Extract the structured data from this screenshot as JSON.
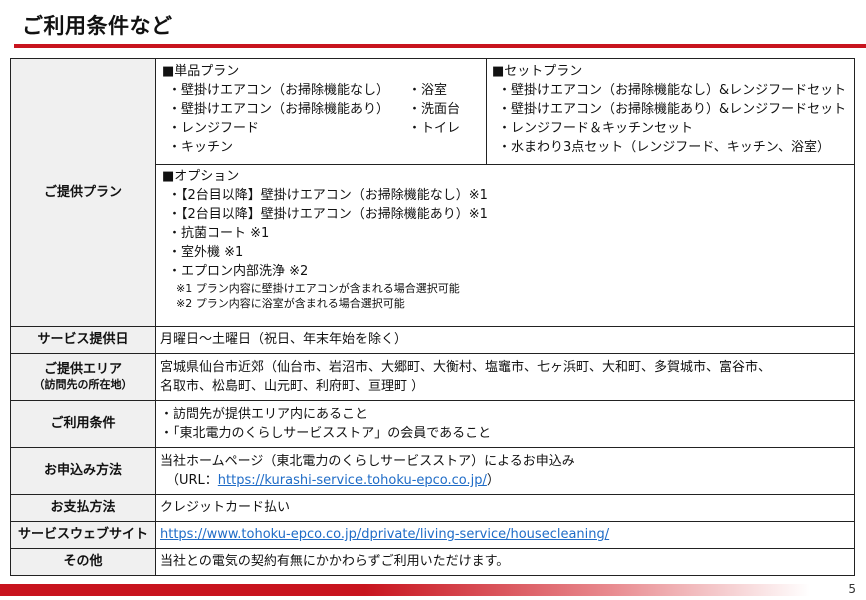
{
  "page_title": "ご利用条件など",
  "page_number": "5",
  "plans": {
    "label": "ご提供プラン",
    "single": {
      "heading": "■単品プラン",
      "col1": [
        "・壁掛けエアコン（お掃除機能なし）",
        "・壁掛けエアコン（お掃除機能あり）",
        "・レンジフード",
        "・キッチン"
      ],
      "col2": [
        "・浴室",
        "・洗面台",
        "・トイレ"
      ]
    },
    "set": {
      "heading": "■セットプラン",
      "items": [
        "・壁掛けエアコン（お掃除機能なし）&レンジフードセット",
        "・壁掛けエアコン（お掃除機能あり）&レンジフードセット",
        "・レンジフード＆キッチンセット",
        "・水まわり3点セット（レンジフード、キッチン、浴室）"
      ]
    },
    "options": {
      "heading": "■オプション",
      "items": [
        "・【2台目以降】壁掛けエアコン（お掃除機能なし）※1",
        "・【2台目以降】壁掛けエアコン（お掃除機能あり）※1",
        "・抗菌コート ※1",
        "・室外機 ※1",
        "・エプロン内部洗浄 ※2"
      ],
      "notes": [
        "※1 プラン内容に壁掛けエアコンが含まれる場合選択可能",
        "※2 プラン内容に浴室が含まれる場合選択可能"
      ]
    }
  },
  "service_days": {
    "label": "サービス提供日",
    "value": "月曜日～土曜日（祝日、年末年始を除く）"
  },
  "area": {
    "label": "ご提供エリア",
    "sublabel": "（訪問先の所在地）",
    "line1": "宮城県仙台市近郊（仙台市、岩沼市、大郷町、大衡村、塩竈市、七ヶ浜町、大和町、多賀城市、富谷市、",
    "line2": "名取市、松島町、山元町、利府町、亘理町 ）"
  },
  "conditions": {
    "label": "ご利用条件",
    "items": [
      "・訪問先が提供エリア内にあること",
      "・「東北電力のくらしサービスストア」の会員であること"
    ]
  },
  "apply": {
    "label": "お申込み方法",
    "line1": "当社ホームページ（東北電力のくらしサービスストア）によるお申込み",
    "url_prefix": "（URL：",
    "url": "https://kurashi-service.tohoku-epco.co.jp/",
    "url_suffix": "）"
  },
  "payment": {
    "label": "お支払方法",
    "value": "クレジットカード払い"
  },
  "website": {
    "label": "サービスウェブサイト",
    "url": "https://www.tohoku-epco.co.jp/dprivate/living-service/housecleaning/"
  },
  "other": {
    "label": "その他",
    "value": "当社との電気の契約有無にかかわらずご利用いただけます。"
  },
  "colors": {
    "accent": "#c8141e",
    "link": "#1f6cc7",
    "label_bg": "#f0f0f0"
  }
}
